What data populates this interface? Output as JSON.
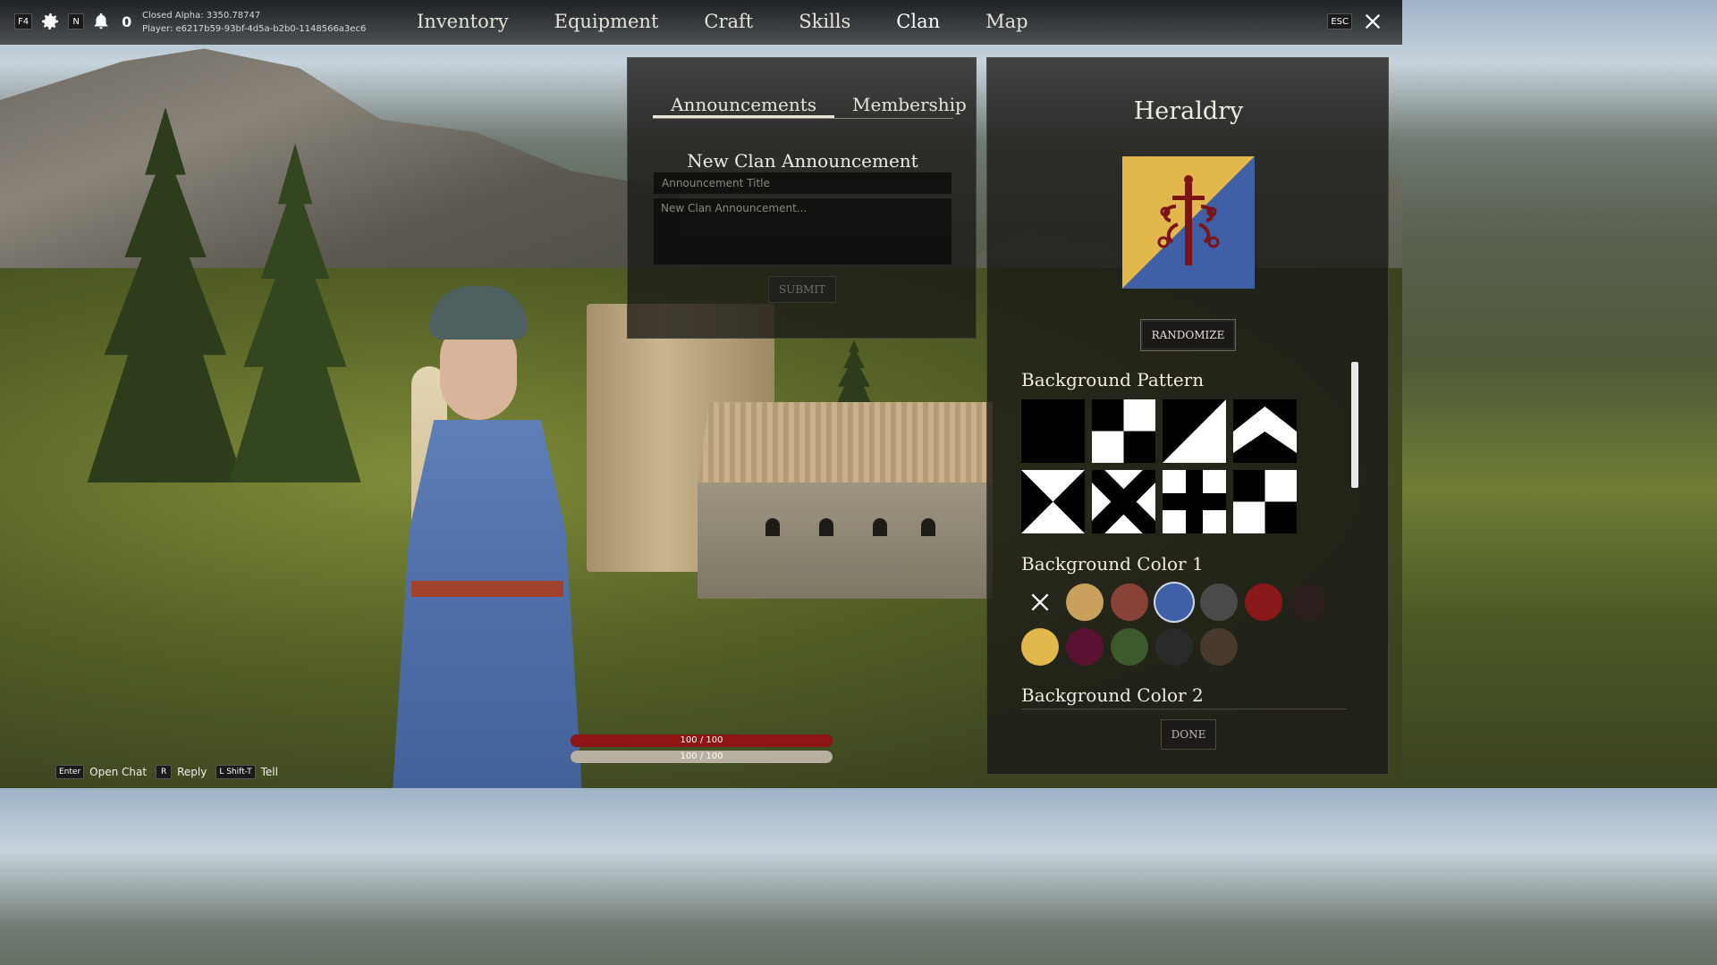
{
  "topbar": {
    "keys": {
      "f4": "F4",
      "n": "N",
      "esc": "ESC"
    },
    "notification_count": "0",
    "build_line": "Closed Alpha: 3350.78747",
    "player_line": "Player: e6217b59-93bf-4d5a-b2b0-1148566a3ec6",
    "nav": [
      "Inventory",
      "Equipment",
      "Craft",
      "Skills",
      "Clan",
      "Map"
    ],
    "active_nav": "Clan"
  },
  "clan_panel": {
    "tabs": [
      "Announcements",
      "Membership"
    ],
    "active_tab": "Announcements",
    "heading": "New Clan Announcement",
    "title_placeholder": "Announcement Title",
    "body_placeholder": "New Clan Announcement...",
    "submit_label": "SUBMIT"
  },
  "heraldry": {
    "title": "Heraldry",
    "crest_colors": {
      "left": "#e2b84c",
      "right": "#3f5fa6",
      "emblem": "#7b1414"
    },
    "randomize_label": "RANDOMIZE",
    "pattern_label": "Background Pattern",
    "color1_label": "Background Color 1",
    "color2_label": "Background Color 2",
    "done_label": "DONE",
    "patterns": [
      "solid",
      "quartered",
      "diagonal",
      "chevron",
      "saltire-hourglass",
      "saltire",
      "cross",
      "checker-offset"
    ],
    "colors": [
      "none",
      "#c9a15d",
      "#8a4238",
      "#3f5fa6",
      "#4a4a4a",
      "#8a1818",
      "#2c1e1c",
      "#e2b84c",
      "#5a1232",
      "#3c5a2c",
      "#2a2a2a",
      "#4a3a2e"
    ],
    "selected_color": "#3f5fa6"
  },
  "status": {
    "health": "100 / 100",
    "stamina": "100 / 100",
    "health_fraction": 1.0,
    "stamina_fraction": 1.0
  },
  "hotkeys": [
    {
      "key": "Enter",
      "label": "Open Chat"
    },
    {
      "key": "R",
      "label": "Reply"
    },
    {
      "key": "L Shift-T",
      "label": "Tell"
    }
  ]
}
